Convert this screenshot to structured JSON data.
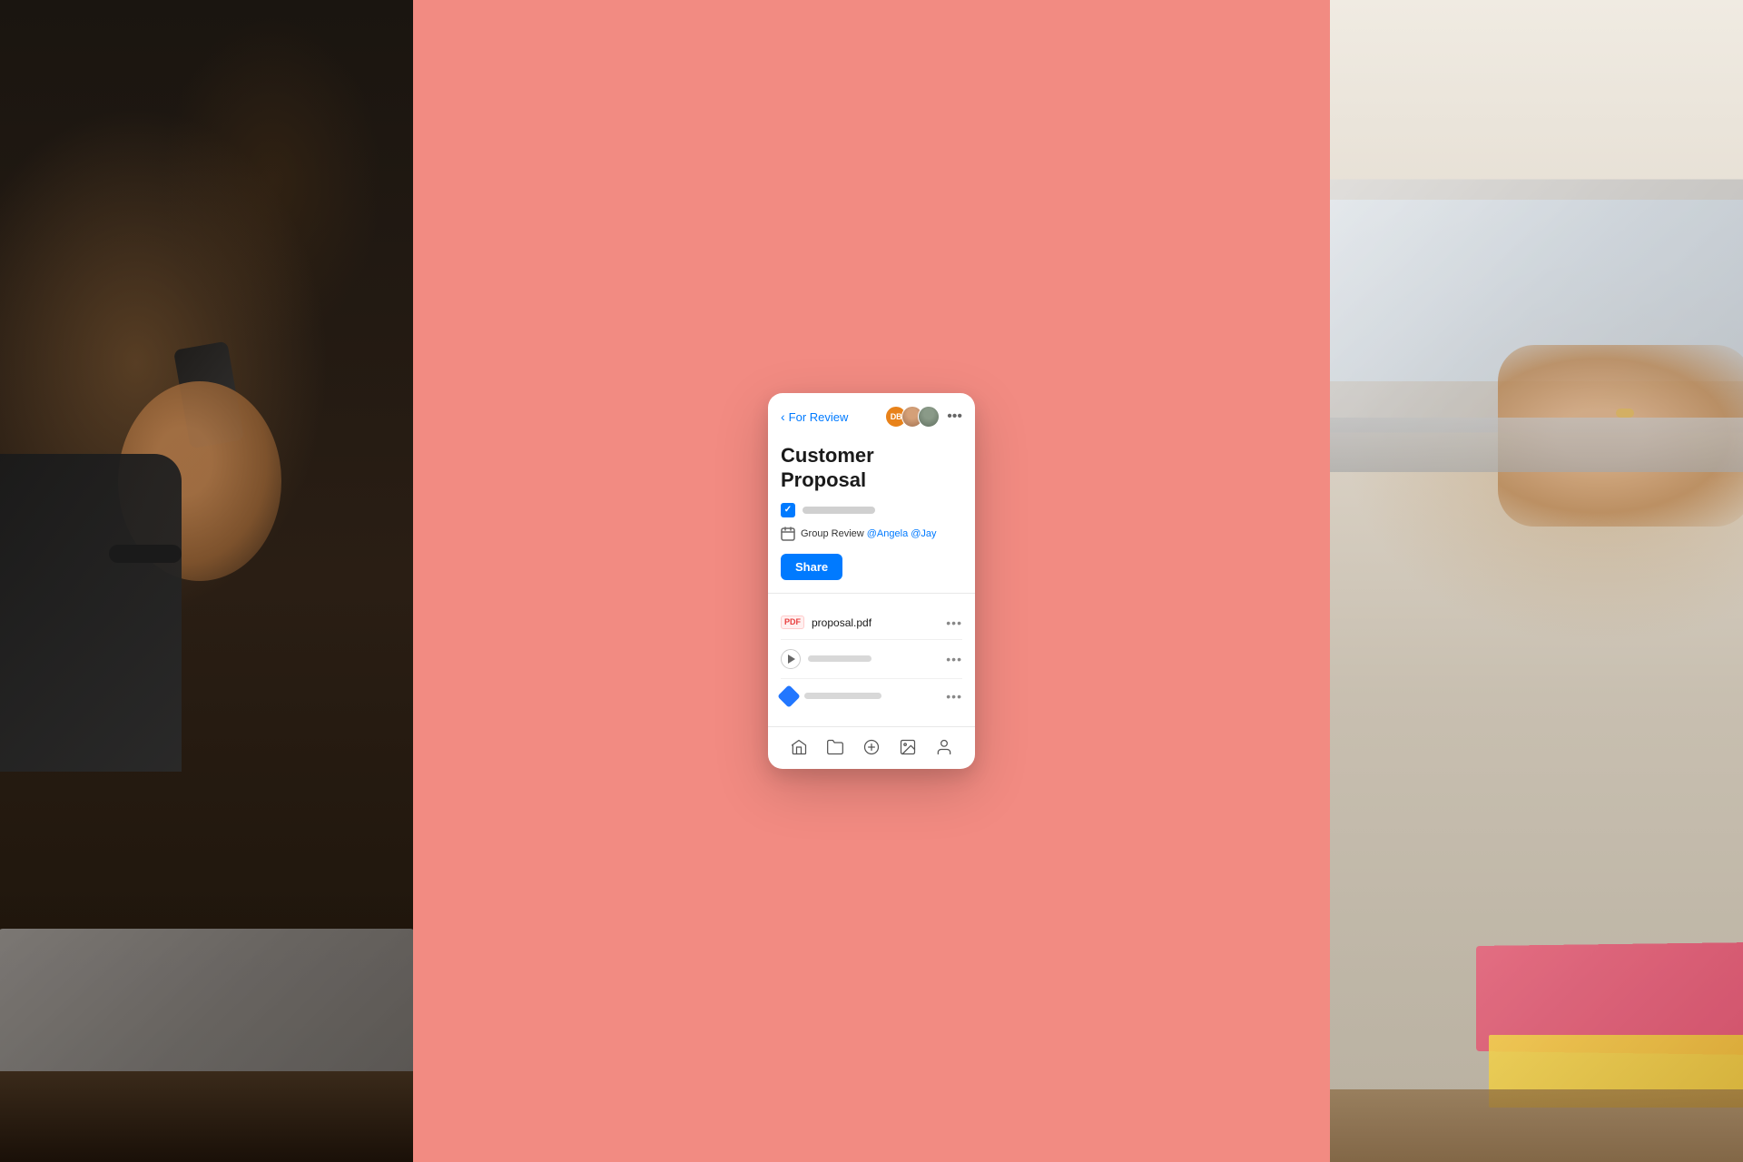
{
  "layout": {
    "bg_color_center": "#f28b82",
    "bg_color_left": "#1a1510",
    "bg_color_right": "#d4cfc0"
  },
  "header": {
    "back_label": "For Review",
    "more_dots": "•••",
    "avatars": [
      {
        "id": "db",
        "initials": "DB",
        "color": "#e8821a"
      },
      {
        "id": "f",
        "initials": "",
        "color": "#888888"
      },
      {
        "id": "m",
        "initials": "",
        "color": "#5a7a6a"
      }
    ]
  },
  "document": {
    "title_line1": "Customer",
    "title_line2": "Proposal",
    "task_checked": true,
    "group_review_label": "Group Review",
    "mention_1": "@Angela",
    "mention_2": "@Jay"
  },
  "share_button": {
    "label": "Share"
  },
  "files": [
    {
      "id": "pdf",
      "type": "pdf",
      "name": "proposal.pdf",
      "icon_label": "PDF"
    },
    {
      "id": "audio",
      "type": "audio",
      "name": "",
      "icon_label": "play"
    },
    {
      "id": "doc",
      "type": "doc",
      "name": "",
      "icon_label": "diamond"
    }
  ],
  "bottom_nav": {
    "items": [
      {
        "id": "home",
        "label": "Home",
        "icon": "home"
      },
      {
        "id": "folder",
        "label": "Folder",
        "icon": "folder"
      },
      {
        "id": "add",
        "label": "Add",
        "icon": "plus"
      },
      {
        "id": "image",
        "label": "Image",
        "icon": "image"
      },
      {
        "id": "profile",
        "label": "Profile",
        "icon": "user"
      }
    ]
  }
}
